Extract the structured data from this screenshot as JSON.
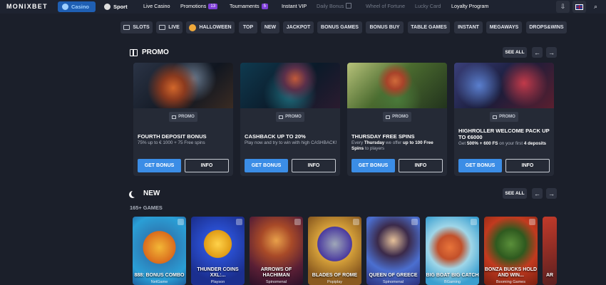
{
  "topbar": {
    "logo": "MONIXBET",
    "casino": "Casino",
    "sport": "Sport",
    "nav": [
      "Live Casino",
      "Promotions",
      "Tournaments",
      "Instant VIP",
      "Daily Bonus",
      "Wheel of Fortune",
      "Lucky Card",
      "Loyalty Program"
    ],
    "promotions_badge": "13",
    "tournaments_badge": "5"
  },
  "categories": [
    "SLOTS",
    "LIVE",
    "HALLOWEEN",
    "TOP",
    "NEW",
    "JACKPOT",
    "BONUS GAMES",
    "BONUS BUY",
    "TABLE GAMES",
    "INSTANT",
    "MEGAWAYS",
    "DROPS&WINS"
  ],
  "promo": {
    "title": "PROMO",
    "see_all": "SEE ALL",
    "tag": "PROMO",
    "get_bonus": "GET BONUS",
    "info": "INFO",
    "cards": [
      {
        "title": "FOURTH DEPOSIT BONUS",
        "desc": "75% up to € 1000 + 75 Free spins"
      },
      {
        "title": "CASHBACK UP TO 20%",
        "desc": "Play now and try to win with high CASHBACK!"
      },
      {
        "title": "THURSDAY FREE SPINS",
        "desc": "Every Thursday we offer up to 100 Free Spins to players"
      },
      {
        "title": "HIGHROLLER WELCOME PACK UP TO €6000",
        "desc": "Get 500% + 600 FS on your first 4 deposits"
      }
    ]
  },
  "new": {
    "title": "NEW",
    "see_all": "SEE ALL",
    "count": "165+ GAMES",
    "games": [
      {
        "name": "888: BONUS COMBO",
        "provider": "NetGame"
      },
      {
        "name": "THUNDER COINS XXL:...",
        "provider": "Playson"
      },
      {
        "name": "ARROWS OF HACHIMAN",
        "provider": "Spinomenal"
      },
      {
        "name": "BLADES OF ROME",
        "provider": "Popiplay"
      },
      {
        "name": "QUEEN OF GREECE",
        "provider": "Spinomenal"
      },
      {
        "name": "BIG BOAT BIG CATCH",
        "provider": "BGaming"
      },
      {
        "name": "BONZA BUCKS HOLD AND WIN...",
        "provider": "Booming Games"
      },
      {
        "name": "AR",
        "provider": ""
      }
    ]
  }
}
